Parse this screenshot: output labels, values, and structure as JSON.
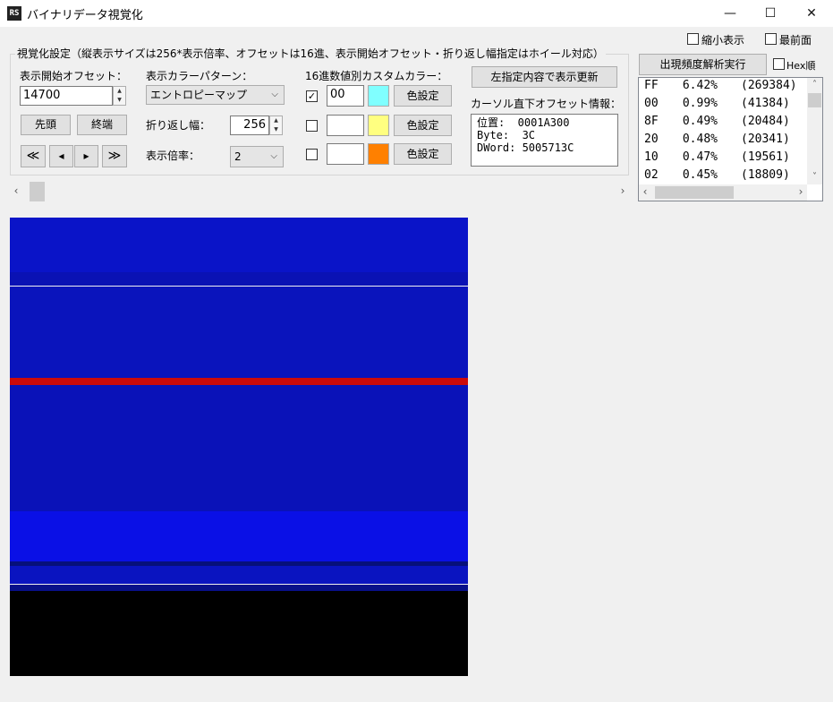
{
  "window": {
    "icon_text": "RS",
    "title": "バイナリデータ視覚化",
    "minimize_glyph": "—",
    "maximize_glyph": "☐",
    "close_glyph": "✕"
  },
  "top_options": {
    "compact_label": "縮小表示",
    "compact_checked": false,
    "topmost_label": "最前面",
    "topmost_checked": false
  },
  "settings": {
    "group_title": "視覚化設定（縦表示サイズは256*表示倍率、オフセットは16進、表示開始オフセット・折り返し幅指定はホイール対応）",
    "start_offset_label": "表示開始オフセット：",
    "start_offset_value": "14700",
    "head_button": "先頭",
    "end_button": "終端",
    "nav_first": "≪",
    "nav_prev": "◂",
    "nav_next": "▸",
    "nav_last": "≫",
    "color_pattern_label": "表示カラーパターン：",
    "color_pattern_value": "エントロピーマップ",
    "wrap_width_label": "折り返し幅：",
    "wrap_width_value": "256",
    "zoom_label": "表示倍率：",
    "zoom_value": "2",
    "custom_color_label": "16進数値別カスタムカラー：",
    "custom_colors": [
      {
        "checked": true,
        "value": "00",
        "color": "#80ffff",
        "button": "色設定"
      },
      {
        "checked": false,
        "value": "",
        "color": "#ffff80",
        "button": "色設定"
      },
      {
        "checked": false,
        "value": "",
        "color": "#ff8000",
        "button": "色設定"
      }
    ],
    "refresh_button": "左指定内容で表示更新",
    "cursor_info_label": "カーソル直下オフセット情報：",
    "cursor_info_text": "位置:  0001A300\nByte:  3C\nDWord: 5005713C"
  },
  "scroll": {
    "left_arrow": "‹",
    "right_arrow": "›",
    "up_arrow": "˄",
    "down_arrow": "˅"
  },
  "frequency": {
    "run_button": "出現頻度解析実行",
    "hex_order_label": "Hex順",
    "hex_order_checked": false,
    "rows": [
      {
        "byte": "FF",
        "percent": "6.42%",
        "count": "(269384)"
      },
      {
        "byte": "00",
        "percent": "0.99%",
        "count": "(41384)"
      },
      {
        "byte": "8F",
        "percent": "0.49%",
        "count": "(20484)"
      },
      {
        "byte": "20",
        "percent": "0.48%",
        "count": "(20341)"
      },
      {
        "byte": "10",
        "percent": "0.47%",
        "count": "(19561)"
      },
      {
        "byte": "02",
        "percent": "0.45%",
        "count": "(18809)"
      }
    ]
  },
  "visualization": {
    "bands": [
      {
        "from": 0.0,
        "to": 0.12,
        "color": "#0a14c8"
      },
      {
        "from": 0.12,
        "to": 0.15,
        "color": "#0a12b4"
      },
      {
        "from": 0.15,
        "to": 0.35,
        "color": "#0a14bc"
      },
      {
        "from": 0.35,
        "to": 0.365,
        "color": "#cc0a0a"
      },
      {
        "from": 0.365,
        "to": 0.64,
        "color": "#0a12b8"
      },
      {
        "from": 0.64,
        "to": 0.75,
        "color": "#0a10e6"
      },
      {
        "from": 0.75,
        "to": 0.76,
        "color": "#06107a"
      },
      {
        "from": 0.76,
        "to": 0.8,
        "color": "#0a14c0"
      },
      {
        "from": 0.8,
        "to": 0.815,
        "color": "#08108a"
      },
      {
        "from": 0.815,
        "to": 1.0,
        "color": "#000000"
      }
    ]
  }
}
